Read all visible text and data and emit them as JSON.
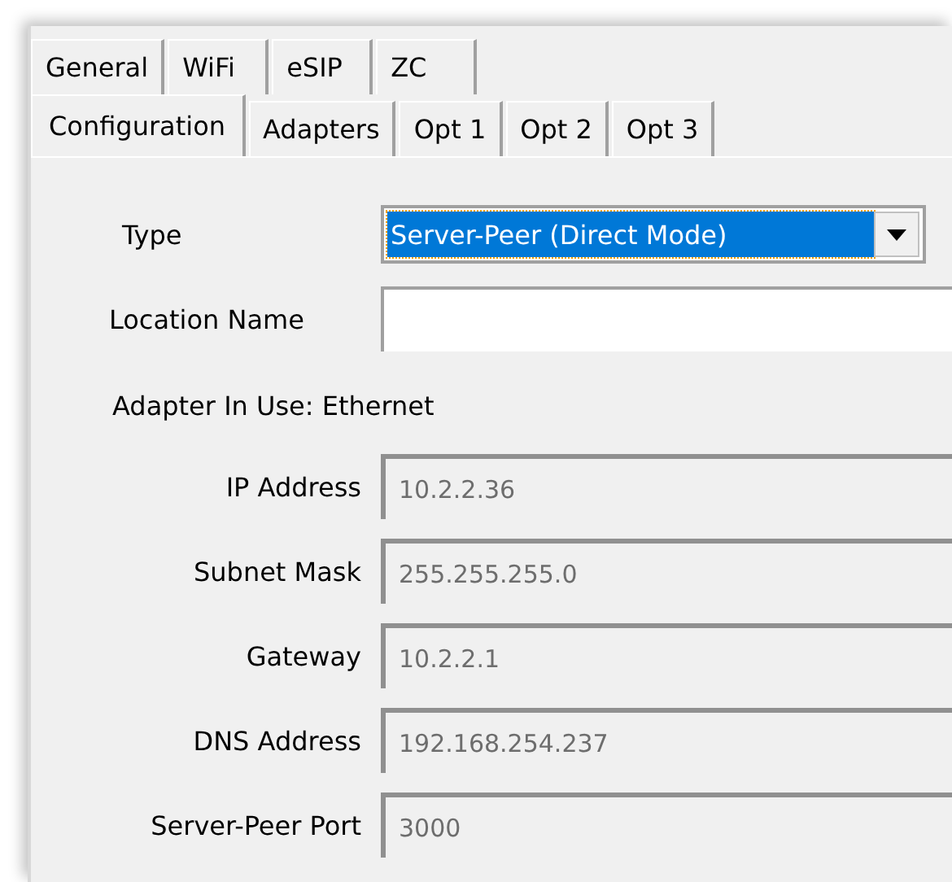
{
  "tab_rows": [
    {
      "tabs": [
        {
          "label": "General",
          "selected": false
        },
        {
          "label": "WiFi",
          "selected": false
        },
        {
          "label": "eSIP",
          "selected": false
        },
        {
          "label": "ZC",
          "selected": false
        }
      ]
    },
    {
      "tabs": [
        {
          "label": "Configuration",
          "selected": true
        },
        {
          "label": "Adapters",
          "selected": false
        },
        {
          "label": "Opt 1",
          "selected": false
        },
        {
          "label": "Opt 2",
          "selected": false
        },
        {
          "label": "Opt 3",
          "selected": false
        }
      ]
    }
  ],
  "type_field": {
    "label": "Type",
    "value": "Server-Peer (Direct Mode)",
    "focused": true
  },
  "location_field": {
    "label": "Location Name"
  },
  "adapter_in_use": "Adapter In Use: Ethernet",
  "fields": [
    {
      "label": "IP Address",
      "value": "10.2.2.36",
      "disabled": true
    },
    {
      "label": "Subnet Mask",
      "value": "255.255.255.0",
      "disabled": true
    },
    {
      "label": "Gateway",
      "value": "10.2.2.1",
      "disabled": true
    },
    {
      "label": "DNS Address",
      "value": "192.168.254.237",
      "disabled": true
    },
    {
      "label": "Server-Peer Port",
      "value": "3000",
      "disabled": true
    }
  ]
}
